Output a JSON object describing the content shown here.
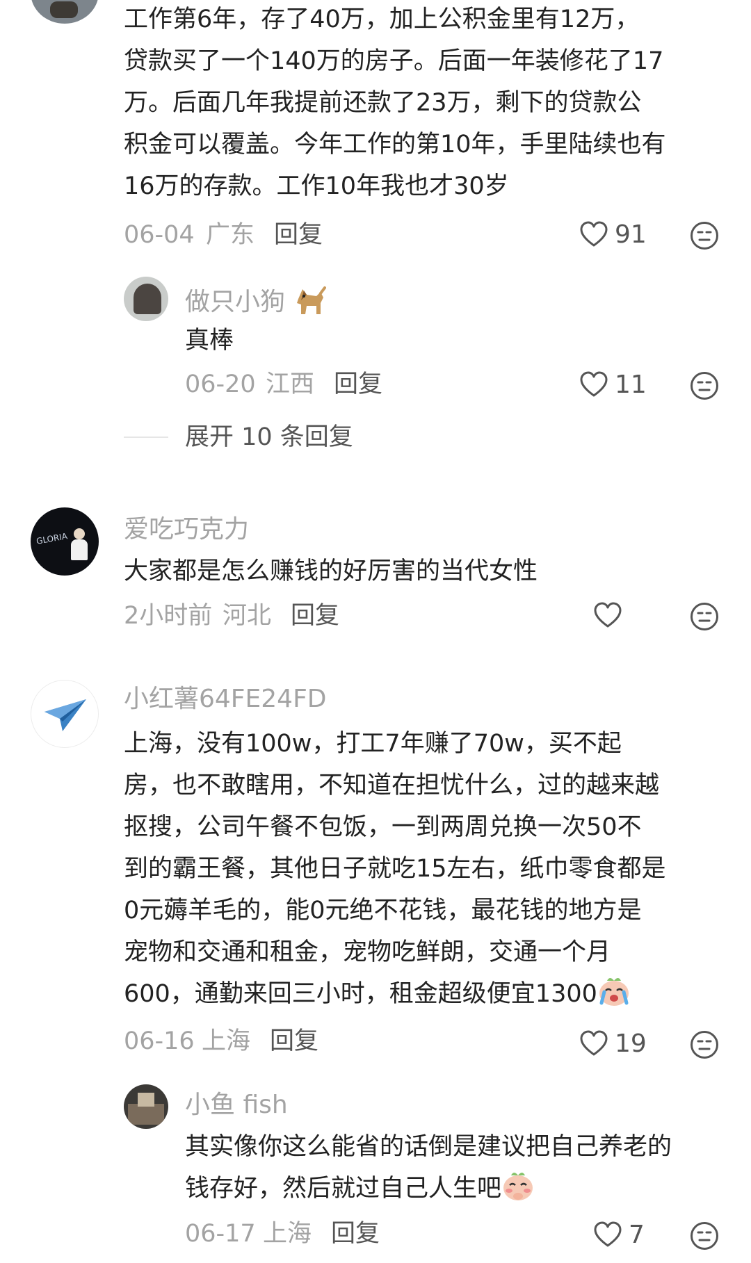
{
  "comments": [
    {
      "text_lines": [
        "工作第6年，存了40万，加上公积金里有12万，",
        "贷款买了一个140万的房子。后面一年装修花了17",
        "万。后面几年我提前还款了23万，剩下的贷款公",
        "积金可以覆盖。今年工作的第10年，手里陆续也有",
        "16万的存款。工作10年我也才30岁"
      ],
      "date": "06-04",
      "location": "广东",
      "reply_label": "回复",
      "likes": "91",
      "replies": [
        {
          "username": "做只小狗",
          "name_emoji": "dog",
          "text": "真棒",
          "date": "06-20",
          "location": "江西",
          "reply_label": "回复",
          "likes": "11"
        }
      ],
      "expand_label": "展开 10 条回复"
    },
    {
      "username": "爱吃巧克力",
      "avatar_text": "GLORIA",
      "text_lines": [
        "大家都是怎么赚钱的好厉害的当代女性"
      ],
      "date": "2小时前",
      "location": "河北",
      "reply_label": "回复",
      "likes": ""
    },
    {
      "username": "小红薯64FE24FD",
      "avatar_icon": "paper-plane-icon",
      "text_lines": [
        "上海，没有100w，打工7年赚了70w，买不起",
        "房，也不敢瞎用，不知道在担忧什么，过的越来越",
        "抠搜，公司午餐不包饭，一到两周兑换一次50不",
        "到的霸王餐，其他日子就吃15左右，纸巾零食都是",
        "0元薅羊毛的，能0元绝不花钱，最花钱的地方是",
        "宠物和交通和租金，宠物吃鲜朗，交通一个月",
        "600，通勤来回三小时，租金超级便宜1300"
      ],
      "text_emoji": "crying-face",
      "date": "06-16",
      "location": "上海",
      "reply_label": "回复",
      "likes": "19",
      "replies": [
        {
          "username": "小鱼 fish",
          "text_lines": [
            "其实像你这么能省的话倒是建议把自己养老的",
            "钱存好，然后就过自己人生吧"
          ],
          "text_emoji": "shy-face",
          "date": "06-17",
          "location": "上海",
          "reply_label": "回复",
          "likes": "7"
        }
      ]
    }
  ],
  "colors": {
    "text": "#222222",
    "meta": "#a3a3a3",
    "icon": "#555555"
  }
}
